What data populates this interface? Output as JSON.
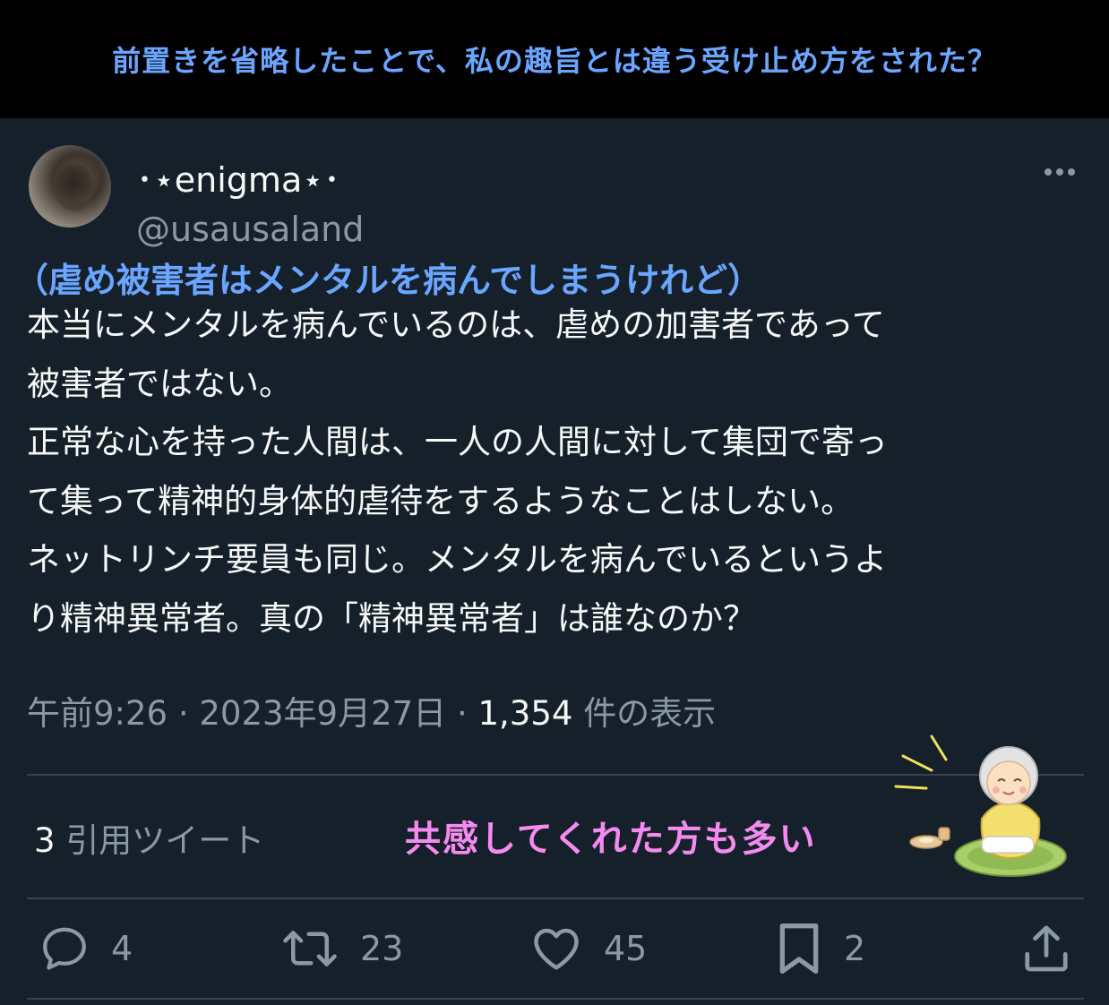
{
  "banner": {
    "text": "前置きを省略したことで、私の趣旨とは違う受け止め方をされた？"
  },
  "author": {
    "display_name": "･⋆enigma⋆･",
    "handle": "@usausaland",
    "avatar_icon": "avatar-photo"
  },
  "overlay_caption": "（虐め被害者はメンタルを病んでしまうけれど）",
  "tweet": {
    "lines": [
      "本当にメンタルを病んでいるのは、虐めの加害者であって",
      "被害者ではない。",
      "正常な心を持った人間は、一人の人間に対して集団で寄っ",
      "て集って精神的身体的虐待をするようなことはしない。",
      "ネットリンチ要員も同じ。メンタルを病んでいるというよ",
      "り精神異常者。真の「精神異常者」は誰なのか？"
    ],
    "time": "午前9:26",
    "date": "2023年9月27日",
    "views_count": "1,354",
    "views_label": "件の表示"
  },
  "quotes": {
    "count": "3",
    "label": "引用ツイート"
  },
  "annotation": {
    "text": "共感してくれた方も多い"
  },
  "actions": {
    "reply": {
      "icon": "reply-icon",
      "count": "4"
    },
    "retweet": {
      "icon": "retweet-icon",
      "count": "23"
    },
    "like": {
      "icon": "like-icon",
      "count": "45"
    },
    "bookmark": {
      "icon": "bookmark-icon",
      "count": "2"
    },
    "share": {
      "icon": "share-icon"
    }
  },
  "colors": {
    "background": "#15202b",
    "banner_background": "#000000",
    "banner_text": "#6aa6ff",
    "primary_text": "#f7f9f9",
    "secondary_text": "#8b98a5",
    "annotation_pink": "#f58bf0",
    "divider": "#38444d"
  }
}
